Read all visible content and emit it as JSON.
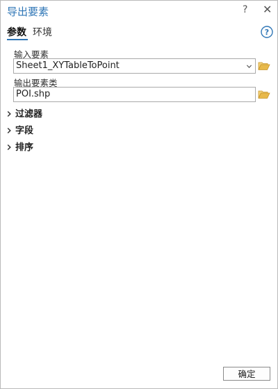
{
  "title_bar": {
    "title": "导出要素",
    "help_label": "?",
    "close_label": "✕"
  },
  "tabs": [
    {
      "label": "参数",
      "active": true
    },
    {
      "label": "环境",
      "active": false
    }
  ],
  "help_icon": "help-circle-icon",
  "fields": {
    "input_features": {
      "label": "输入要素",
      "value": "Sheet1_XYTableToPoint"
    },
    "output_feature_class": {
      "label": "输出要素类",
      "value": "POI.shp"
    }
  },
  "sections": [
    {
      "label": "过滤器"
    },
    {
      "label": "字段"
    },
    {
      "label": "排序"
    }
  ],
  "footer": {
    "ok_label": "确定"
  },
  "colors": {
    "accent": "#2f76b6",
    "folder": "#e8b94a",
    "border": "#a9a9a9"
  }
}
